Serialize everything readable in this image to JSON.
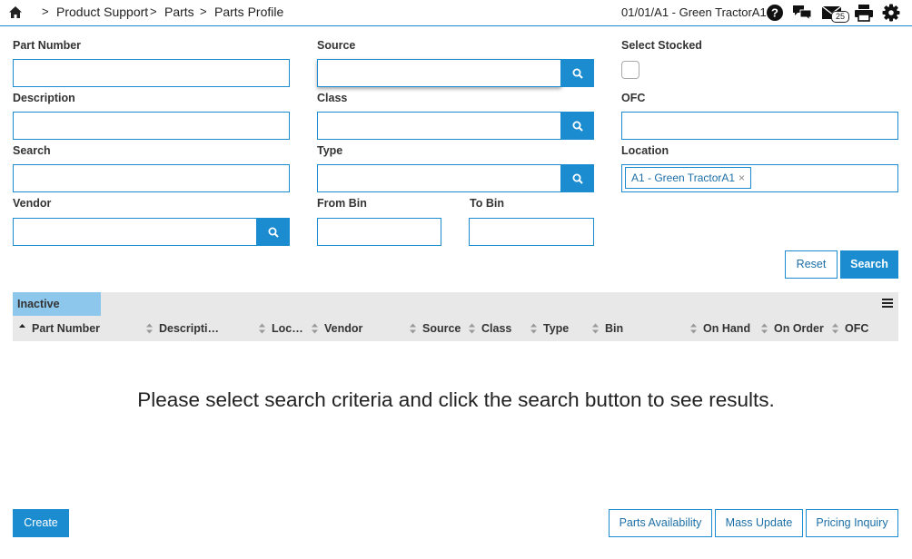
{
  "breadcrumb": {
    "home_icon": "home-icon",
    "sep": ">",
    "items": [
      "Product Support",
      "Parts",
      "Parts Profile"
    ]
  },
  "header": {
    "store": "01/01/A1 - Green TractorA1",
    "mail_count": "25",
    "icons": [
      "help-icon",
      "chat-icon",
      "mail-icon",
      "print-icon",
      "gear-icon"
    ]
  },
  "form": {
    "part_number": {
      "label": "Part Number",
      "value": ""
    },
    "source": {
      "label": "Source",
      "value": ""
    },
    "select_stocked": {
      "label": "Select Stocked",
      "checked": false
    },
    "description": {
      "label": "Description",
      "value": ""
    },
    "class": {
      "label": "Class",
      "value": ""
    },
    "ofc": {
      "label": "OFC",
      "value": ""
    },
    "search": {
      "label": "Search",
      "value": ""
    },
    "type": {
      "label": "Type",
      "value": ""
    },
    "location": {
      "label": "Location",
      "chip": "A1 - Green TractorA1",
      "chip_remove": "×"
    },
    "vendor": {
      "label": "Vendor",
      "value": ""
    },
    "from_bin": {
      "label": "From Bin",
      "value": ""
    },
    "to_bin": {
      "label": "To Bin",
      "value": ""
    }
  },
  "actions": {
    "reset": "Reset",
    "search": "Search"
  },
  "grid": {
    "tab": "Inactive",
    "columns": [
      "Part Number",
      "Descripti…",
      "Loc…",
      "Vendor",
      "Source",
      "Class",
      "Type",
      "Bin",
      "On Hand",
      "On Order",
      "OFC"
    ],
    "empty_message": "Please select search criteria and click the search button to see results."
  },
  "footer": {
    "create": "Create",
    "parts_availability": "Parts Availability",
    "mass_update": "Mass Update",
    "pricing_inquiry": "Pricing Inquiry"
  },
  "colors": {
    "accent": "#1b8ccf",
    "tab": "#8ec7ec",
    "grid_bg": "#e8e8e8"
  }
}
